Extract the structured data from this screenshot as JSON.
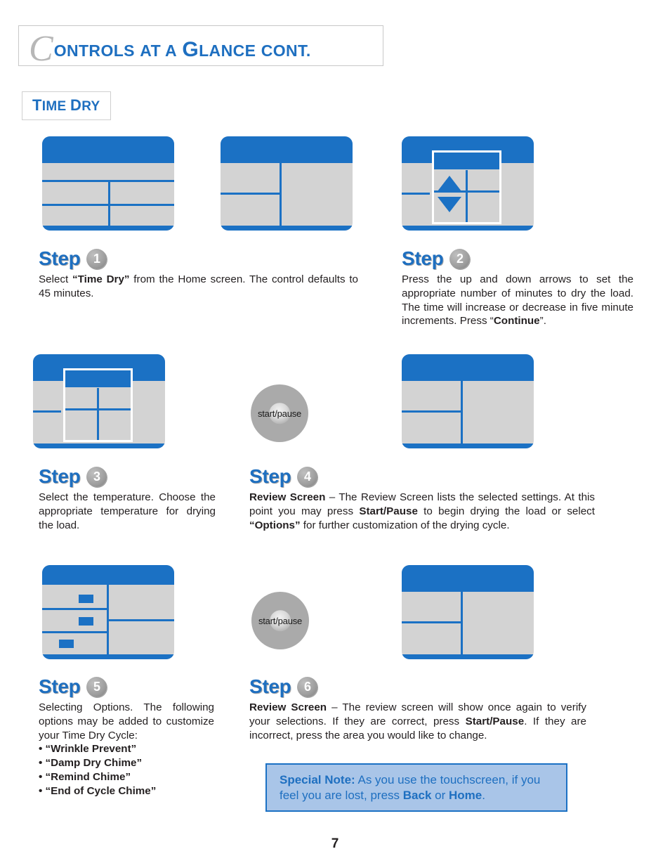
{
  "header": {
    "drop_cap": "C",
    "title_rest_1": "ONTROLS",
    "title_rest_2": "AT A",
    "title_cap_g": "G",
    "title_rest_3": "LANCE",
    "title_rest_4": "CONT."
  },
  "section": {
    "label_t": "T",
    "label_ime": "IME",
    "label_d": "D",
    "label_ry": "RY"
  },
  "steps": [
    {
      "word": "Step",
      "number": "1",
      "body_html": "Select <b>&ldquo;Time Dry&rdquo;</b> from the Home screen.  The control defaults to 45 minutes."
    },
    {
      "word": "Step",
      "number": "2",
      "body_html": "Press the up and down arrows to set the appropriate number of minutes to dry the load. The time will increase or decrease in five minute increments. Press &ldquo;<b>Continue</b>&rdquo;."
    },
    {
      "word": "Step",
      "number": "3",
      "body_html": "Select the temperature.   Choose the appropriate temperature for drying the load."
    },
    {
      "word": "Step",
      "number": "4",
      "body_html": "<b>Review Screen</b> &ndash; The Review Screen lists the selected settings. At this point you may press <b>Start/Pause</b> to begin drying the load or select <b>&ldquo;Options&rdquo;</b> for further customization of the drying cycle."
    },
    {
      "word": "Step",
      "number": "5",
      "body_html": "Selecting Options.   The following options may be added to customize your Time Dry Cycle:"
    },
    {
      "word": "Step",
      "number": "6",
      "body_html": "<b>Review Screen</b> &ndash; The review screen will show once again to verify your selections.  If they are correct, press <b>Start/Pause</b>.  If they are incorrect, press the area you would like to change."
    }
  ],
  "options": [
    "• “Wrinkle Prevent”",
    "• “Damp Dry Chime”",
    "• “Remind Chime”",
    "• “End of Cycle Chime”"
  ],
  "knobs": {
    "label": "start/pause"
  },
  "special_note": {
    "html": "<b>Special Note:</b>  As you use the touchscreen, if you feel you are lost, press <b>Back</b> or <b>Home</b>."
  },
  "footer": {
    "page_number": "7"
  },
  "colors": {
    "blue": "#1b71c4",
    "title_blue": "#1e6fc0",
    "screen_gray": "#d3d3d3",
    "note_bg": "#a9c5e8",
    "knob_gray": "#aaaaaa"
  }
}
